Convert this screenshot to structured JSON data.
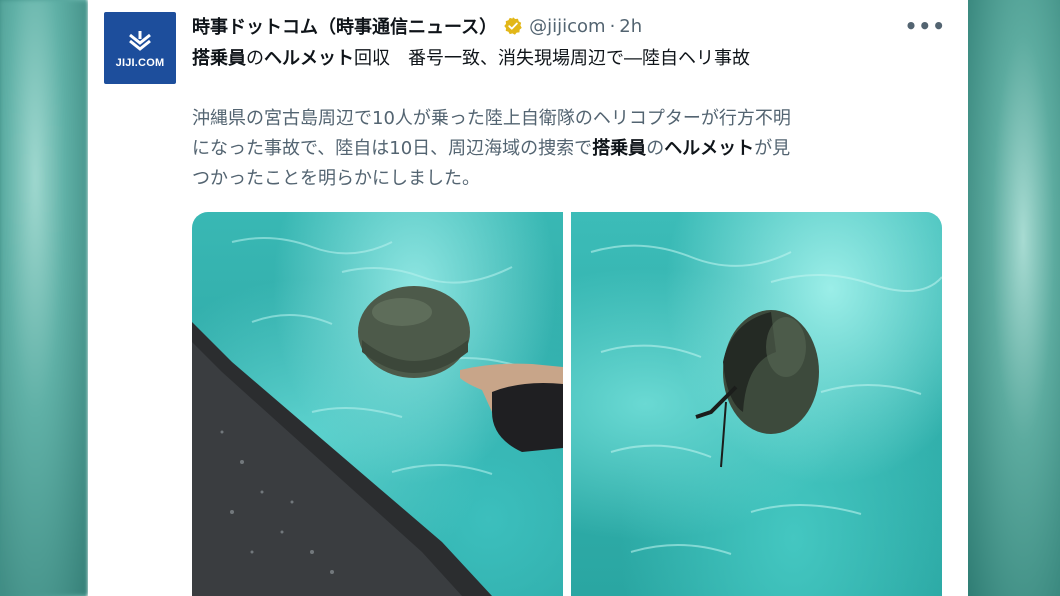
{
  "tweet": {
    "avatar_text": "JIJI.COM",
    "display_name": "時事ドットコム（時事通信ニュース）",
    "handle": "@jijicom",
    "separator": "·",
    "time": "2h",
    "more_label": "•••",
    "headline_parts": [
      "搭乗員",
      "の",
      "ヘルメット",
      "回収　番号一致、消失現場周辺で―陸自ヘリ事故"
    ],
    "body_lines": [
      {
        "pre": "沖縄県の宮古島周辺で10人が乗った陸上自衛隊のヘリコプターが行方不明",
        "bold1": "",
        "mid": "",
        "bold2": "",
        "post": ""
      },
      {
        "pre": "になった事故で、陸自は10日、周辺海域の捜索で",
        "bold1": "搭乗員",
        "mid": "の",
        "bold2": "ヘルメット",
        "post": "が見"
      },
      {
        "pre": "つかったことを明らかにしました。",
        "bold1": "",
        "mid": "",
        "bold2": "",
        "post": ""
      }
    ],
    "icons": {
      "avatar": "jiji-logo-icon",
      "verified": "verified-badge-icon",
      "more": "more-options-icon"
    }
  },
  "colors": {
    "avatar_bg": "#1d4e9c",
    "verified_gold": "#e2b719",
    "text_primary": "#0f1419",
    "text_secondary": "#536471",
    "water": "#39b8b4"
  }
}
